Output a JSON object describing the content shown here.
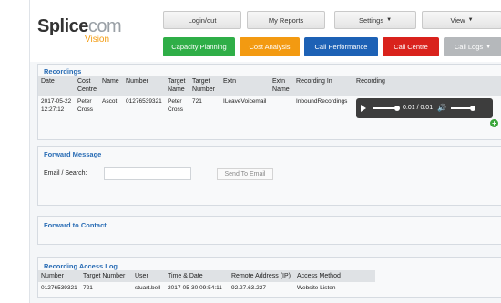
{
  "brand": {
    "name_part1": "Splice",
    "name_part2": "com",
    "sub": "Vision"
  },
  "nav": {
    "login": "Login/out",
    "reports": "My Reports",
    "settings": "Settings",
    "view": "View"
  },
  "actions": {
    "capacity": "Capacity Planning",
    "cost": "Cost Analysis",
    "performance": "Call Performance",
    "centre": "Call Centre",
    "logs": "Call Logs"
  },
  "colors": {
    "capacity": "#2fae47",
    "cost": "#f39a11",
    "performance": "#1d61b5",
    "centre": "#d9221c",
    "logs": "#b5b8bb"
  },
  "recordings": {
    "title": "Recordings",
    "headers": [
      "Date",
      "Cost Centre",
      "Name",
      "Number",
      "Target Name",
      "Target Number",
      "Extn",
      "Extn Name",
      "Recording In",
      "Recording"
    ],
    "rows": [
      {
        "date": "2017-05-22 12:27:12",
        "cost_centre": "Peter Cross",
        "name": "Ascot",
        "number": "01276539321",
        "target_name": "Peter Cross",
        "target_number": "721",
        "extn": "ILeaveVoicemail",
        "extn_name": "",
        "recording_in": "InboundRecordings",
        "player_time": "0:01 / 0:01"
      }
    ]
  },
  "forward_message": {
    "title": "Forward Message",
    "label": "Email / Search:",
    "input_value": "",
    "send_label": "Send To Email"
  },
  "forward_contact": {
    "title": "Forward to Contact"
  },
  "access_log": {
    "title": "Recording Access Log",
    "headers": [
      "Number",
      "Target Number",
      "User",
      "Time & Date",
      "Remote Address (IP)",
      "Access Method"
    ],
    "rows": [
      {
        "number": "01276539321",
        "target_number": "721",
        "user": "stuart.bell",
        "time": "2017-05-30 09:54:11",
        "ip": "92.27.63.227",
        "method": "Website Listen"
      }
    ]
  }
}
